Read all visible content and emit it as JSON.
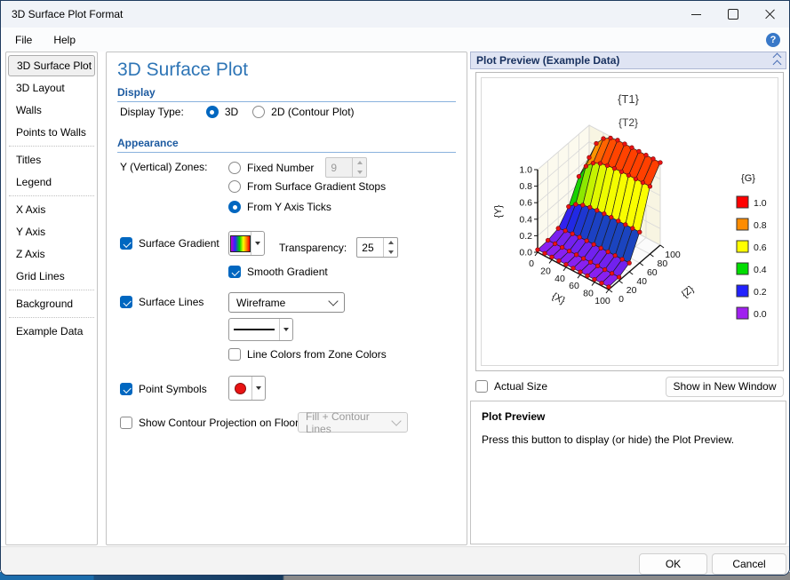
{
  "window": {
    "title": "3D Surface Plot Format"
  },
  "menu": {
    "items": [
      {
        "label": "File"
      },
      {
        "label": "Help"
      }
    ],
    "help_glyph": "?"
  },
  "sidebar": {
    "items": [
      {
        "label": "3D Surface Plot",
        "selected": true
      },
      {
        "label": "3D Layout",
        "selected": false
      },
      {
        "label": "Walls",
        "selected": false
      },
      {
        "label": "Points to Walls",
        "selected": false
      },
      {
        "label": "Titles",
        "selected": false
      },
      {
        "label": "Legend",
        "selected": false
      },
      {
        "label": "X Axis",
        "selected": false
      },
      {
        "label": "Y Axis",
        "selected": false
      },
      {
        "label": "Z Axis",
        "selected": false
      },
      {
        "label": "Grid Lines",
        "selected": false
      },
      {
        "label": "Background",
        "selected": false
      },
      {
        "label": "Example Data",
        "selected": false
      }
    ],
    "separators_after": [
      3,
      5,
      9,
      10
    ]
  },
  "main": {
    "heading": "3D Surface Plot",
    "display": {
      "header": "Display",
      "type_label": "Display Type:",
      "options": [
        {
          "label": "3D",
          "selected": true
        },
        {
          "label": "2D (Contour Plot)",
          "selected": false
        }
      ]
    },
    "appearance_header": "Appearance",
    "zones": {
      "label": "Y (Vertical) Zones:",
      "options": [
        {
          "label": "Fixed Number",
          "selected": false
        },
        {
          "label": "From Surface Gradient Stops",
          "selected": false
        },
        {
          "label": "From Y Axis Ticks",
          "selected": true
        }
      ],
      "fixed_number_value": "9"
    },
    "surface_gradient": {
      "label": "Surface Gradient",
      "checked": true,
      "transparency_label": "Transparency:",
      "transparency_value": "25",
      "smooth_label": "Smooth Gradient",
      "smooth_checked": true
    },
    "surface_lines": {
      "label": "Surface Lines",
      "checked": true,
      "style_value": "Wireframe",
      "line_colors_label": "Line Colors from Zone Colors",
      "line_colors_checked": false
    },
    "point_symbols": {
      "label": "Point Symbols",
      "checked": true
    },
    "contour": {
      "label": "Show Contour Projection on Floor",
      "checked": false,
      "mode_value": "Fill + Contour Lines"
    }
  },
  "preview": {
    "header": "Plot Preview (Example Data)",
    "actual_size_label": "Actual Size",
    "actual_size_checked": false,
    "show_button": "Show in New Window",
    "info_title": "Plot Preview",
    "info_text": "Press this button to display (or hide) the Plot Preview."
  },
  "buttons": {
    "ok": "OK",
    "cancel": "Cancel"
  },
  "chart_data": {
    "type": "surface3d",
    "title": "{T1}",
    "subtitle": "{T2}",
    "xlabel": "{X}",
    "ylabel": "{Y}",
    "zlabel": "{Z}",
    "x_ticks": [
      0,
      20,
      40,
      60,
      80,
      100
    ],
    "z_ticks": [
      0,
      20,
      40,
      60,
      80,
      100
    ],
    "y_ticks": [
      "0.0",
      "0.2",
      "0.4",
      "0.6",
      "0.8",
      "1.0"
    ],
    "y_range": [
      0,
      1
    ],
    "legend": {
      "title": "{G}",
      "entries": [
        {
          "label": "1.0",
          "color": "#ff0000"
        },
        {
          "label": "0.8",
          "color": "#ff8c00"
        },
        {
          "label": "0.6",
          "color": "#ffff00"
        },
        {
          "label": "0.4",
          "color": "#00dd00"
        },
        {
          "label": "0.2",
          "color": "#2222ff"
        },
        {
          "label": "0.0",
          "color": "#a020f0"
        }
      ]
    },
    "colormap": [
      [
        "0.0",
        "#a020f0"
      ],
      [
        "0.2",
        "#2222ee"
      ],
      [
        "0.4",
        "#00cc00"
      ],
      [
        "0.6",
        "#ffff00"
      ],
      [
        "0.8",
        "#ff8c00"
      ],
      [
        "1.0",
        "#ff0000"
      ]
    ],
    "surface": {
      "x_step": 10,
      "z_step": 20,
      "sigmoid_mid": 68,
      "sigmoid_rate": 11,
      "x_dip_amp": 0.42,
      "x_dip_rate": 14,
      "base": 0.03,
      "marker_color": "#ea1212"
    }
  }
}
